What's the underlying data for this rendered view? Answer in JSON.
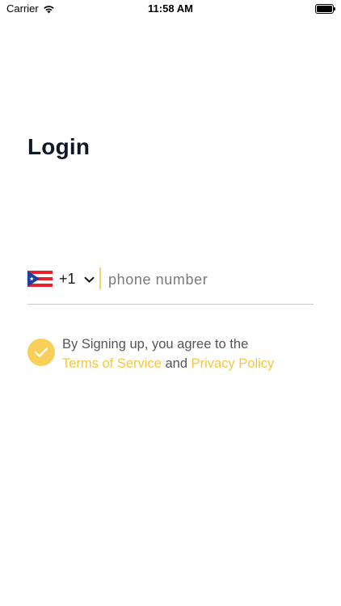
{
  "status_bar": {
    "carrier": "Carrier",
    "time": "11:58 AM",
    "battery_level": 1.0
  },
  "page": {
    "title": "Login"
  },
  "phone_form": {
    "country_flag": "puerto-rico-flag",
    "dial_code": "+1",
    "phone_value": "",
    "phone_placeholder": "phone number"
  },
  "agreement": {
    "checked": true,
    "text_prefix": "By Signing up, you agree to the",
    "terms_label": "Terms of Service",
    "conjunction": "and",
    "privacy_label": "Privacy Policy"
  },
  "colors": {
    "accent": "#f5c63f",
    "check_background": "#f8cf58",
    "divider": "#f7d36a",
    "underline": "#c9c9c9",
    "title": "#111827"
  }
}
